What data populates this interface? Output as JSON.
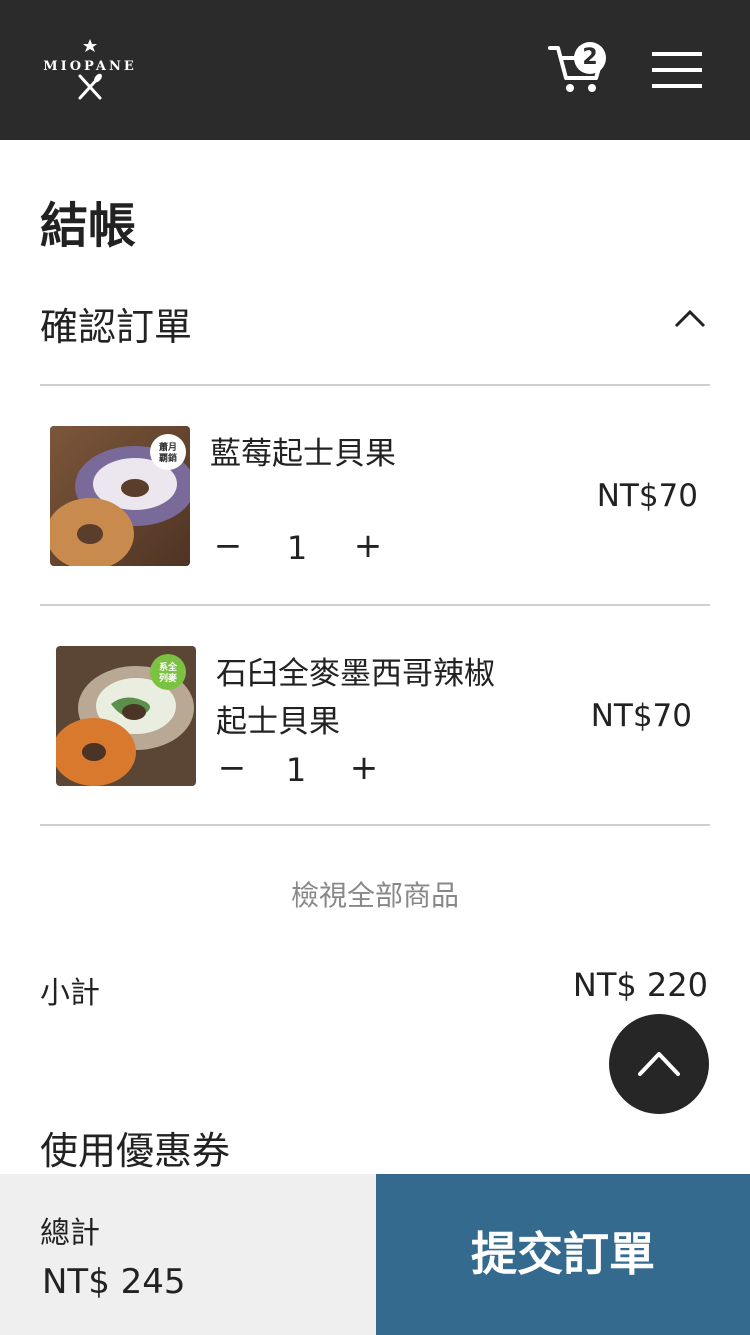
{
  "header": {
    "logo_text": "MIOPANE",
    "cart_count": "2"
  },
  "page": {
    "title": "結帳",
    "section_title": "確認訂單"
  },
  "items": [
    {
      "name_line1": "藍莓起士貝果",
      "name_line2": "",
      "price": "NT$70",
      "quantity": "1",
      "minus": "−",
      "plus": "+",
      "badge": [
        "蕭月",
        "覇銷"
      ]
    },
    {
      "name_line1": "石臼全麥墨西哥辣椒",
      "name_line2": "起士貝果",
      "price": "NT$70",
      "quantity": "1",
      "minus": "−",
      "plus": "+",
      "badge": [
        "系全",
        "列麥"
      ]
    }
  ],
  "view_all": "檢視全部商品",
  "subtotal": {
    "label": "小計",
    "value": "NT$ 220"
  },
  "coupon": {
    "title": "使用優惠券"
  },
  "footer": {
    "total_label": "總計",
    "total_value": "NT$ 245",
    "submit_label": "提交訂單"
  },
  "colors": {
    "header_bg": "#2b2b2b",
    "submit_bg": "#336a8d",
    "footer_left_bg": "#efefef",
    "badge_green": "#7cc242"
  }
}
